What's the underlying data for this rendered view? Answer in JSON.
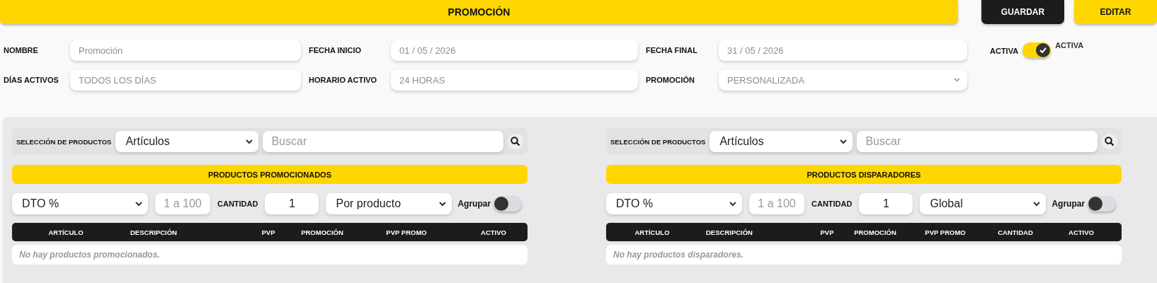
{
  "header": {
    "title": "PROMOCIÓN",
    "buttons": [
      {
        "label": "GUARDAR",
        "kind": "dark"
      },
      {
        "label": "EDITAR",
        "kind": "accent"
      }
    ]
  },
  "form": {
    "rows": [
      [
        {
          "label": "NOMBRE",
          "kind": "text",
          "value": "Promoción",
          "disabled": true
        },
        {
          "label": "FECHA INICIO",
          "kind": "text",
          "value": "01 / 05 / 2026",
          "disabled": true
        },
        {
          "label": "FECHA FINAL",
          "kind": "text",
          "value": "31 / 05 / 2026",
          "disabled": true
        }
      ],
      [
        {
          "label": "DÍAS ACTIVOS",
          "kind": "text",
          "value": "TODOS LOS DÍAS",
          "disabled": true
        },
        {
          "label": "HORARIO ACTIVO",
          "kind": "text",
          "value": "24 HORAS",
          "disabled": true
        },
        {
          "label": "PROMOCIÓN",
          "kind": "select",
          "value": "PERSONALIZADA",
          "disabled": true
        }
      ]
    ],
    "active": {
      "label": "ACTIVA",
      "on": true,
      "caption": "ACTIVA"
    }
  },
  "panels": [
    {
      "selector_label": "SELECCIÓN DE PRODUCTOS",
      "selector_value": "Artículos",
      "search_placeholder": "Buscar",
      "title": "PRODUCTOS PROMOCIONADOS",
      "discount_type": "DTO %",
      "amount_placeholder": "1 a 100",
      "quantity_label": "CANTIDAD",
      "quantity": "1",
      "mode": "Por producto",
      "group_label": "Agrupar",
      "group_on": false,
      "columns": [
        "ARTÍCULO",
        "DESCRIPCIÓN",
        "PVP",
        "PROMOCIÓN",
        "PVP PROMO",
        "ACTIVO"
      ],
      "empty_text": "No hay productos promocionados."
    },
    {
      "selector_label": "SELECCIÓN DE PRODUCTOS",
      "selector_value": "Artículos",
      "search_placeholder": "Buscar",
      "title": "PRODUCTOS DISPARADORES",
      "discount_type": "DTO %",
      "amount_placeholder": "1 a 100",
      "quantity_label": "CANTIDAD",
      "quantity": "1",
      "mode": "Global",
      "group_label": "Agrupar",
      "group_on": false,
      "columns": [
        "ARTÍCULO",
        "DESCRIPCIÓN",
        "PVP",
        "PROMOCIÓN",
        "PVP PROMO",
        "CANTIDAD",
        "ACTIVO"
      ],
      "empty_text": "No hay productos disparadores."
    }
  ]
}
